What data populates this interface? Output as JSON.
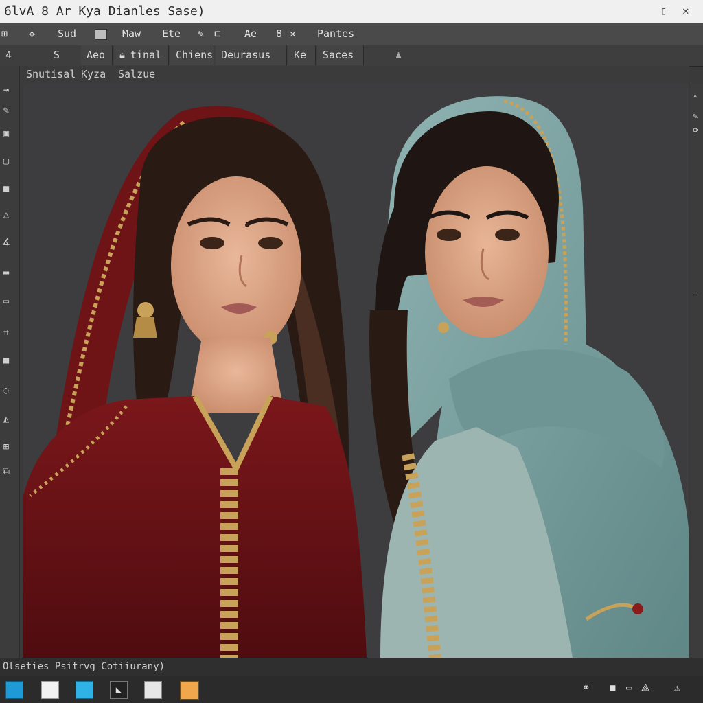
{
  "window": {
    "title": "6lvA 8 Ar  Kya Dianles  Sase)",
    "controls": [
      "minimize-icon",
      "close-icon"
    ]
  },
  "menubar": {
    "items": [
      "Sud",
      "Maw",
      "Ete",
      "Ae",
      "8",
      "Pantes"
    ]
  },
  "tabs": {
    "items": [
      "4",
      "S",
      "Aeo",
      "tinal",
      "Chiens",
      "Deurasus e",
      "Ke",
      "Saces"
    ]
  },
  "infobar": {
    "items": [
      "Snutisal",
      "Kyza",
      "Salzue"
    ]
  },
  "statusbar": {
    "text": "Olseties Psitrvg Cotiiurany)"
  },
  "colors": {
    "accent": "#1e9bd7",
    "canvas_bg": "#3d3d3f",
    "left_dress": "#6e1417",
    "right_scarf": "#7fa3a3",
    "gold": "#c9a25a"
  },
  "taskbar": {
    "apps": [
      "window-app-icon",
      "file-app-icon",
      "blue-app-icon",
      "editor-app-icon",
      "image-app-icon",
      "active-app-icon"
    ]
  }
}
